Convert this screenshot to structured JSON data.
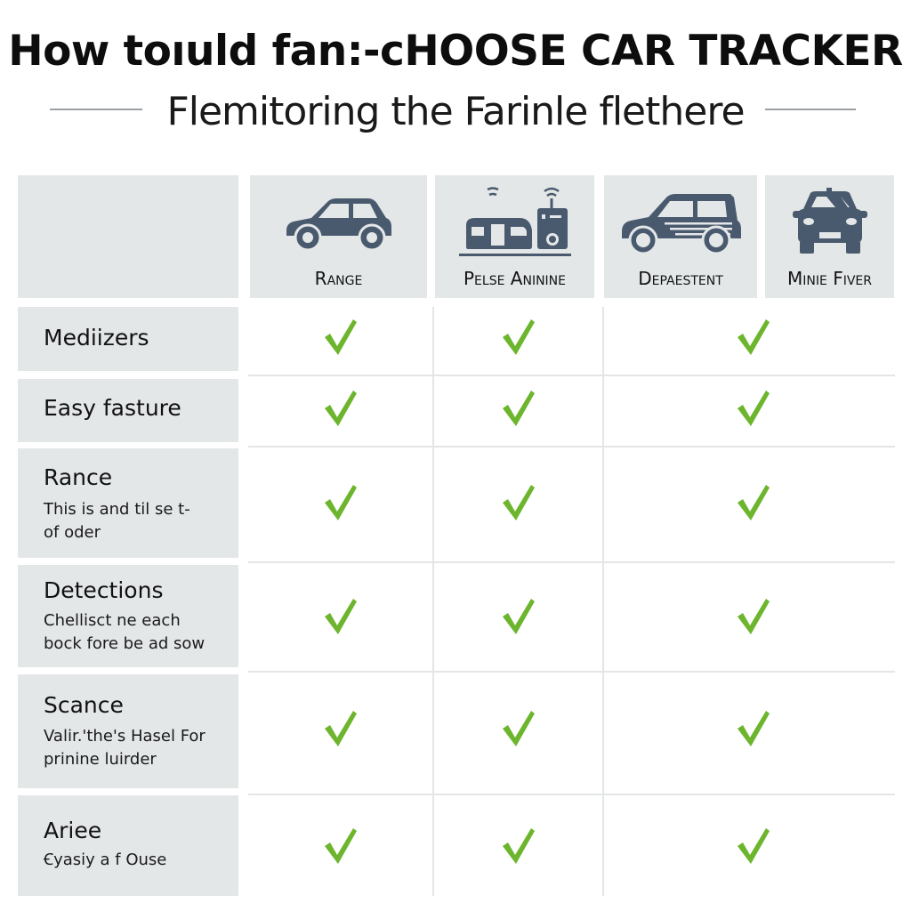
{
  "header": {
    "title": "How toıuld fan:-cHOOSE CAR TRACKER",
    "subtitle": "Flemitoring the Farinle flethere"
  },
  "columns": [
    {
      "label": "Range",
      "icon": "hatchback-car-icon"
    },
    {
      "label": "Pelse Aninine",
      "icon": "van-and-tracker-device-icon"
    },
    {
      "label": "Depaestent",
      "icon": "suv-car-icon"
    },
    {
      "label": "Minie Fiver",
      "icon": "car-front-view-icon"
    }
  ],
  "rows": [
    {
      "name": "Mediizers",
      "desc": "",
      "checks": [
        true,
        true,
        true
      ]
    },
    {
      "name": "Easy fasture",
      "desc": "",
      "checks": [
        true,
        true,
        true
      ]
    },
    {
      "name": "Rance",
      "desc": "This is and til se t-\nof oder",
      "desc_lines": [
        "This is and til se t-",
        "of oder"
      ],
      "checks": [
        true,
        true,
        true
      ]
    },
    {
      "name": "Detections",
      "desc_lines": [
        "Chellisct ne each",
        "bock fore be ad sow"
      ],
      "checks": [
        true,
        true,
        true
      ]
    },
    {
      "name": "Scance",
      "desc_lines": [
        "Valir.'the's Hasel For",
        "prinine luirder"
      ],
      "checks": [
        true,
        true,
        true
      ]
    },
    {
      "name": "Ariee",
      "desc_lines": [
        "Ꞓyasiy a f Ouse"
      ],
      "checks": [
        true,
        true,
        true
      ]
    }
  ],
  "colors": {
    "cell_grey": "#e4e7e8",
    "icon_slate": "#4a5a6e",
    "check_green": "#6cb52d",
    "divider": "#e3e5e6"
  }
}
